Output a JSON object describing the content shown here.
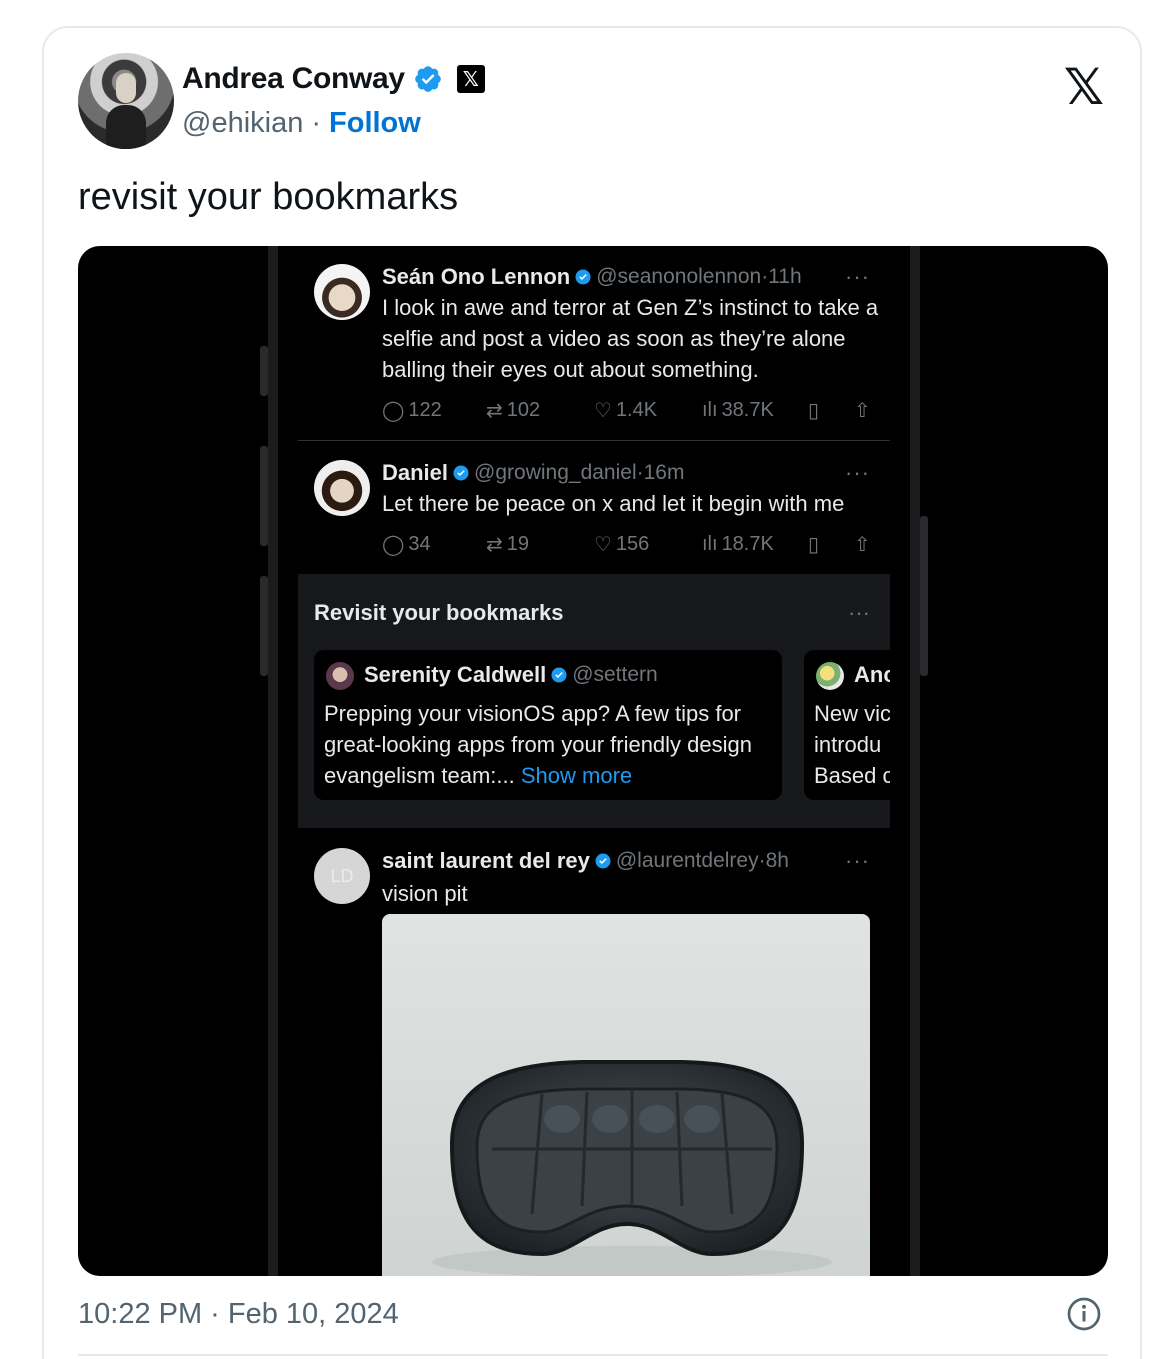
{
  "author": {
    "name": "Andrea Conway",
    "handle": "@ehikian",
    "separator": "·",
    "follow_label": "Follow"
  },
  "x_logo": "𝕏",
  "tweet_text": "revisit your bookmarks",
  "timestamp": "10:22 PM · Feb 10, 2024",
  "colors": {
    "verified": "#1d9bf0",
    "follow": "#0074d4",
    "bookmark_bg": "#16181c"
  },
  "screenshot": {
    "tweets": [
      {
        "name": "Seán Ono Lennon",
        "meta": "@seanonolennon·11h",
        "more": "···",
        "text": "I look in awe and terror at Gen Z’s instinct to take a selfie and post a video as soon as they’re alone balling their eyes out about something.",
        "replies": "122",
        "reposts": "102",
        "likes": "1.4K",
        "views": "38.7K"
      },
      {
        "name": "Daniel",
        "meta": "@growing_daniel·16m",
        "more": "···",
        "text": "Let there be peace on x and let it begin with me",
        "replies": "34",
        "reposts": "19",
        "likes": "156",
        "views": "18.7K"
      }
    ],
    "bookmarks": {
      "title": "Revisit your bookmarks",
      "more": "···",
      "card1": {
        "name": "Serenity Caldwell",
        "handle": "@settern",
        "text": "Prepping your visionOS app? A few tips for great-looking apps from your friendly design evangelism team:...",
        "show_more": "Show more"
      },
      "card2": {
        "name": "Anc",
        "line1": "New vic",
        "line2": "introdu",
        "line3": "Based c"
      }
    },
    "tweet3": {
      "name": "saint laurent del rey",
      "meta": "@laurentdelrey·8h",
      "more": "···",
      "avatar_initials": "LD",
      "text": "vision pit"
    }
  }
}
